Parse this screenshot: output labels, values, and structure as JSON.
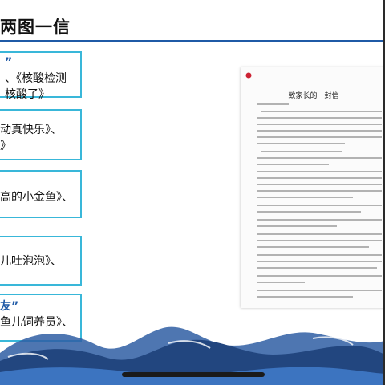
{
  "slide": {
    "title": "两图一信",
    "cards": [
      {
        "lines": [
          "”",
          "、《核酸检测",
          "核酸了》"
        ]
      },
      {
        "lines": [
          "动真快乐》、",
          "》"
        ]
      },
      {
        "lines": [
          "高的小金鱼》、"
        ]
      },
      {
        "lines": [
          "儿吐泡泡》、"
        ]
      },
      {
        "lines": [
          "友”",
          "鱼儿饲养员》、"
        ]
      }
    ]
  },
  "document": {
    "title": "致家长的一封信"
  },
  "colors": {
    "accent": "#1f5aa6",
    "card_border": "#39b7d9",
    "wave_dark": "#22467f"
  }
}
